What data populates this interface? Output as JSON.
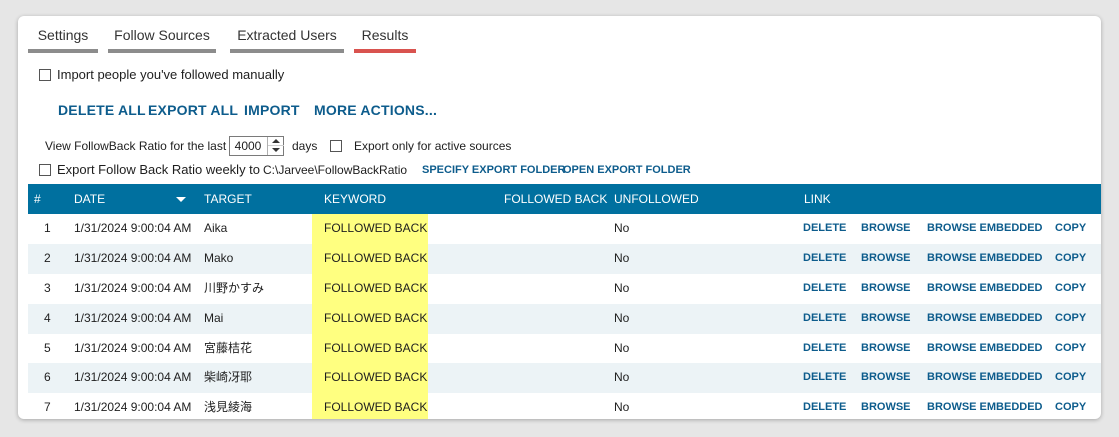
{
  "tabs": [
    {
      "label": "Settings",
      "active": false
    },
    {
      "label": "Follow Sources",
      "active": false
    },
    {
      "label": "Extracted Users",
      "active": false
    },
    {
      "label": "Results",
      "active": true
    }
  ],
  "import_manual": {
    "label": "Import people you've followed manually",
    "checked": false
  },
  "actions": [
    "DELETE ALL",
    "EXPORT ALL",
    "IMPORT",
    "MORE ACTIONS..."
  ],
  "ratio": {
    "prefix": "View FollowBack Ratio for the last",
    "days_value": "4000",
    "suffix": "days",
    "active_only_label": "Export only for active sources",
    "active_only_checked": false
  },
  "weekly_export": {
    "label": "Export Follow Back Ratio weekly  to",
    "checked": false,
    "path": "C:\\Jarvee\\FollowBackRatio",
    "specify_folder": "SPECIFY EXPORT FOLDER",
    "open_folder": "OPEN EXPORT FOLDER"
  },
  "table": {
    "columns": {
      "num": "#",
      "date": "DATE",
      "target": "TARGET",
      "keyword": "KEYWORD",
      "followed_back": "FOLLOWED BACK",
      "unfollowed": "UNFOLLOWED",
      "link": "LINK"
    },
    "sorted_by": "DATE",
    "row_links": {
      "delete": "DELETE",
      "browse": "BROWSE",
      "browse_embedded": "BROWSE EMBEDDED",
      "copy": "COPY"
    },
    "rows": [
      {
        "num": "1",
        "date": "1/31/2024 9:00:04 AM",
        "target": "Aika",
        "keyword": "FOLLOWED BACK",
        "followed_back": "",
        "unfollowed": "No"
      },
      {
        "num": "2",
        "date": "1/31/2024 9:00:04 AM",
        "target": "Mako",
        "keyword": "FOLLOWED BACK",
        "followed_back": "",
        "unfollowed": "No"
      },
      {
        "num": "3",
        "date": "1/31/2024 9:00:04 AM",
        "target": "川野かすみ",
        "keyword": "FOLLOWED BACK",
        "followed_back": "",
        "unfollowed": "No"
      },
      {
        "num": "4",
        "date": "1/31/2024 9:00:04 AM",
        "target": "Mai",
        "keyword": "FOLLOWED BACK",
        "followed_back": "",
        "unfollowed": "No"
      },
      {
        "num": "5",
        "date": "1/31/2024 9:00:04 AM",
        "target": "宮藤桔花",
        "keyword": "FOLLOWED BACK",
        "followed_back": "",
        "unfollowed": "No"
      },
      {
        "num": "6",
        "date": "1/31/2024 9:00:04 AM",
        "target": "柴崎冴耶",
        "keyword": "FOLLOWED BACK",
        "followed_back": "",
        "unfollowed": "No"
      },
      {
        "num": "7",
        "date": "1/31/2024 9:00:04 AM",
        "target": "浅見綾海",
        "keyword": "FOLLOWED BACK",
        "followed_back": "",
        "unfollowed": "No"
      }
    ]
  },
  "colors": {
    "accent": "#0d5c8c",
    "header_bg": "#00709f",
    "active_tab": "#d9534f",
    "keyword_highlight": "#ffff80"
  }
}
